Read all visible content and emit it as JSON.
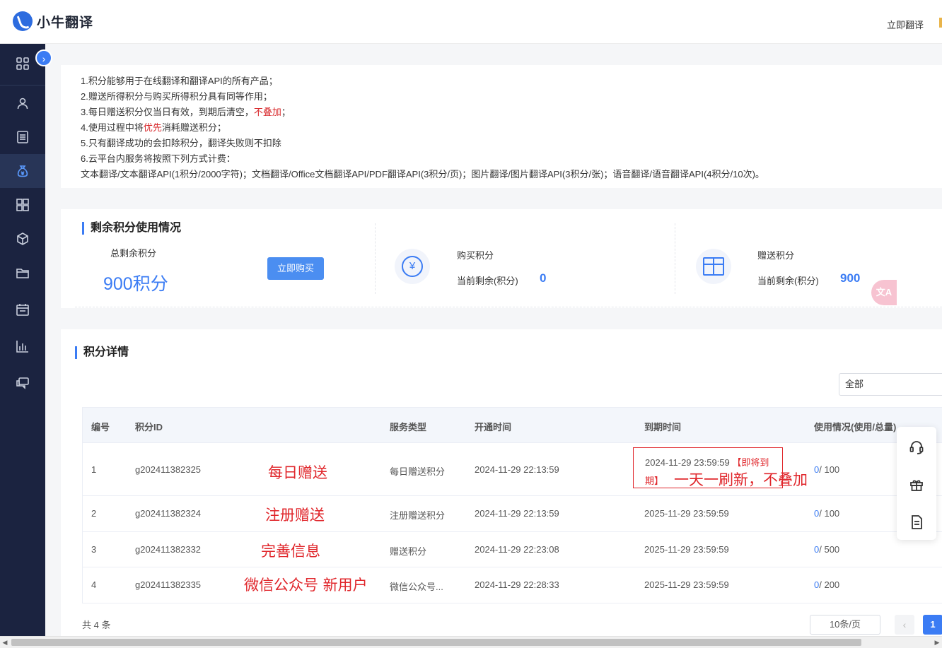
{
  "header": {
    "logo_text": "小牛翻译",
    "translate_link": "立即翻译"
  },
  "sidebar": {
    "items": [
      {
        "icon": "dashboard-icon"
      },
      {
        "icon": "user-icon"
      },
      {
        "icon": "list-icon"
      },
      {
        "icon": "money-bag-icon",
        "active": true
      },
      {
        "icon": "apps-icon"
      },
      {
        "icon": "cube-icon"
      },
      {
        "icon": "folder-icon"
      },
      {
        "icon": "calendar-icon"
      },
      {
        "icon": "stats-icon"
      },
      {
        "icon": "chat-icon"
      }
    ],
    "collapse_glyph": "›"
  },
  "rules": {
    "l1": "1.积分能够用于在线翻译和翻译API的所有产品；",
    "l2": "2.赠送所得积分与购买所得积分具有同等作用；",
    "l3_a": "3.每日赠送积分仅当日有效，到期后清空，",
    "l3_red": "不叠加",
    "l3_b": "；",
    "l4_a": "4.使用过程中将",
    "l4_red": "优先",
    "l4_b": "消耗赠送积分；",
    "l5": "5.只有翻译成功的会扣除积分，翻译失败则不扣除",
    "l6": "6.云平台内服务将按照下列方式计费：",
    "l7": "文本翻译/文本翻译API(1积分/2000字符)；文档翻译/Office文档翻译API/PDF翻译API(3积分/页)；图片翻译/图片翻译API(3积分/张)；语音翻译/语音翻译API(4积分/10次)。"
  },
  "summary": {
    "title": "剩余积分使用情况",
    "total_label": "总剩余积分",
    "total_value": "900积分",
    "buy_button": "立即购买",
    "purchase_title": "购买积分",
    "purchase_remaining_label": "当前剩余(积分)",
    "purchase_remaining_value": "0",
    "gift_title": "赠送积分",
    "gift_remaining_label": "当前剩余(积分)",
    "gift_remaining_value": "900",
    "yuan_glyph": "¥",
    "side_badge": "文A"
  },
  "details": {
    "title": "积分详情",
    "filter_value": "全部",
    "columns": [
      "编号",
      "积分ID",
      "服务类型",
      "开通时间",
      "到期时间",
      "使用情况(使用/总量)"
    ],
    "rows": [
      {
        "no": "1",
        "id": "g202411382325",
        "type": "每日赠送积分",
        "start": "2024-11-29 22:13:59",
        "expire": "2024-11-29 23:59:59",
        "used": "0",
        "total": "/ 100"
      },
      {
        "no": "2",
        "id": "g202411382324",
        "type": "注册赠送积分",
        "start": "2024-11-29 22:13:59",
        "expire": "2025-11-29 23:59:59",
        "used": "0",
        "total": "/ 100"
      },
      {
        "no": "3",
        "id": "g202411382332",
        "type": "赠送积分",
        "start": "2024-11-29 22:23:08",
        "expire": "2025-11-29 23:59:59",
        "used": "0",
        "total": "/ 500"
      },
      {
        "no": "4",
        "id": "g202411382335",
        "type": "微信公众号...",
        "start": "2024-11-29 22:28:33",
        "expire": "2025-11-29 23:59:59",
        "used": "0",
        "total": "/ 200"
      }
    ],
    "expire_soon_a": "【即将到",
    "expire_soon_b": "期】",
    "annotations": {
      "row1": "每日赠送",
      "row1_note": "一天一刷新，不叠加",
      "row2": "注册赠送",
      "row3": "完善信息",
      "row4": "微信公众号 新用户"
    },
    "total_count": "共 4 条",
    "page_size": "10条/页",
    "prev_glyph": "‹",
    "current_page": "1"
  },
  "colors": {
    "accent": "#3b7cf4",
    "sidebar_bg": "#1b2340",
    "annotation_red": "#e0262b"
  }
}
